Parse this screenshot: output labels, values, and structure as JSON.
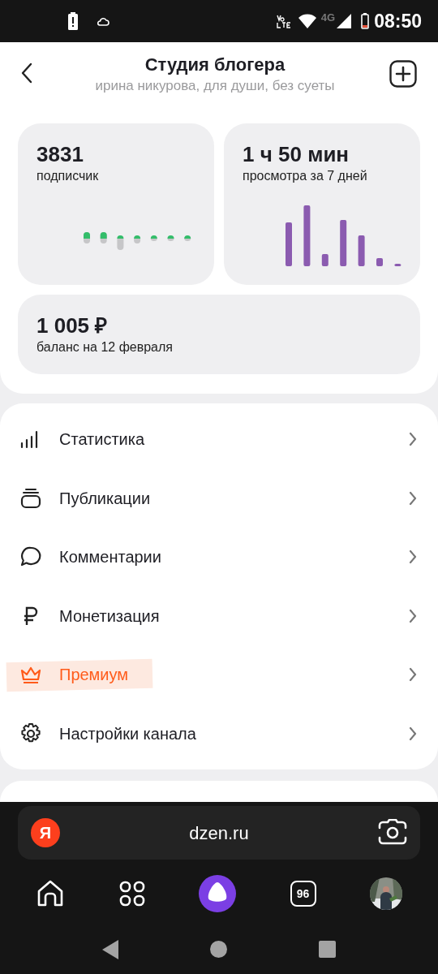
{
  "status_bar": {
    "network": "4G",
    "time": "08:50"
  },
  "header": {
    "title": "Студия блогера",
    "subtitle": "ирина никурова, для души, без суеты"
  },
  "stats": [
    {
      "kind": "subscribers",
      "value": "3831",
      "label": "подписчик"
    },
    {
      "kind": "views",
      "value": "1 ч 50 мин",
      "label": "просмотра за 7 дней"
    },
    {
      "kind": "balance",
      "value": "1 005 ₽",
      "label": "баланс на 12 февраля"
    }
  ],
  "menu": [
    {
      "kind": "stats",
      "label": "Статистика",
      "highlighted": false
    },
    {
      "kind": "publications",
      "label": "Публикации",
      "highlighted": false
    },
    {
      "kind": "comments",
      "label": "Комментарии",
      "highlighted": false
    },
    {
      "kind": "monetization",
      "label": "Монетизация",
      "highlighted": false
    },
    {
      "kind": "premium",
      "label": "Премиум",
      "highlighted": true
    },
    {
      "kind": "settings",
      "label": "Настройки канала",
      "highlighted": false
    }
  ],
  "browser_bar": {
    "logo_letter": "Я",
    "url": "dzen.ru",
    "tabs_count": "96"
  }
}
